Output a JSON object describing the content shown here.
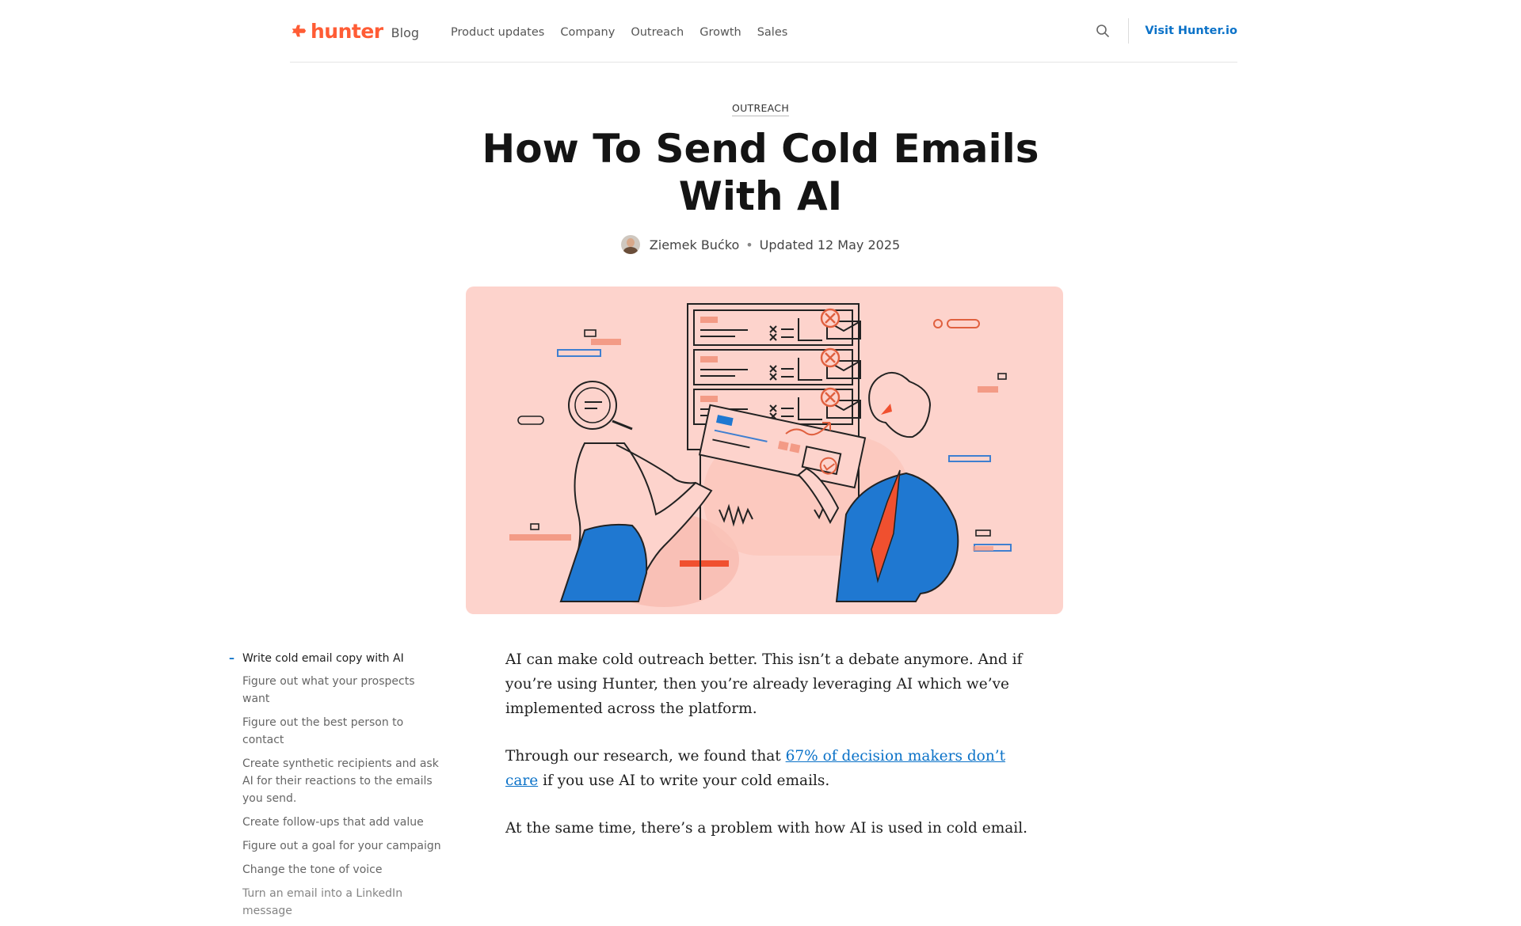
{
  "header": {
    "logo_text": "hunter",
    "blog_label": "Blog",
    "nav": [
      "Product updates",
      "Company",
      "Outreach",
      "Growth",
      "Sales"
    ],
    "visit_label": "Visit Hunter.io"
  },
  "article": {
    "category": "OUTREACH",
    "title": "How To Send Cold Emails With AI",
    "author": "Ziemek Bućko",
    "updated": "Updated 12 May 2025",
    "paragraphs": {
      "p1": "AI can make cold outreach better. This isn’t a debate anymore. And if you’re using Hunter, then you’re already leveraging AI which we’ve implemented across the platform.",
      "p2_before": "Through our research, we found that ",
      "p2_link": "67% of decision makers don’t care",
      "p2_after": " if you use AI to write your cold emails.",
      "p3": "At the same time, there’s a problem with how AI is used in cold email."
    }
  },
  "toc": {
    "active": "Write cold email copy with AI",
    "items": [
      "Figure out what your prospects want",
      "Figure out the best person to contact",
      "Create synthetic recipients and ask AI for their reactions to the emails you send.",
      "Create follow-ups that add value",
      "Figure out a goal for your campaign",
      "Change the tone of voice",
      "Turn an email into a LinkedIn message"
    ]
  },
  "colors": {
    "brand_orange": "#ff5c35",
    "link_blue": "#0b72c8",
    "hero_bg": "#fdd3cc",
    "illustration_blue": "#1f78d1"
  },
  "icons": [
    "hunter-logo-icon",
    "search-icon",
    "avatar"
  ]
}
